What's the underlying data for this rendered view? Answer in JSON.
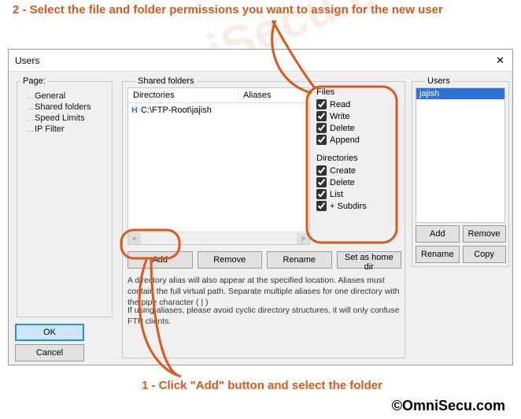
{
  "instructions": {
    "step2": "2 - Select the file and folder permissions you want to assign for the new user",
    "step1": "1 - Click \"Add\" button and select the folder"
  },
  "credit": "©OmniSecu.com",
  "watermark": "OmniSecu.com",
  "dialog": {
    "title": "Users",
    "close_glyph": "✕"
  },
  "page": {
    "label": "Page:",
    "items": [
      "General",
      "Shared folders",
      "Speed Limits",
      "IP Filter"
    ]
  },
  "footer": {
    "ok": "OK",
    "cancel": "Cancel"
  },
  "shared": {
    "group": "Shared folders",
    "headers": {
      "dir": "Directories",
      "alias": "Aliases"
    },
    "rows": [
      {
        "home_marker": "H",
        "path": "C:\\FTP-Root\\jajish",
        "alias": ""
      }
    ],
    "btns": {
      "add": "Add",
      "remove": "Remove",
      "rename": "Rename",
      "sethome": "Set as home dir"
    },
    "help1": "A directory alias will also appear at the specified location. Aliases must contain the full virtual path. Separate multiple aliases for one directory with the pipe character ( | )",
    "help2": "If using aliases, please avoid cyclic directory structures, it will only confuse FTP clients."
  },
  "perms": {
    "files_label": "Files",
    "dirs_label": "Directories",
    "files": {
      "read": "Read",
      "write": "Write",
      "delete": "Delete",
      "append": "Append"
    },
    "dirs": {
      "create": "Create",
      "delete": "Delete",
      "list": "List",
      "subdirs": "+ Subdirs"
    }
  },
  "users": {
    "group": "Users",
    "items": [
      "jajish"
    ],
    "btns": {
      "add": "Add",
      "remove": "Remove",
      "rename": "Rename",
      "copy": "Copy"
    }
  }
}
